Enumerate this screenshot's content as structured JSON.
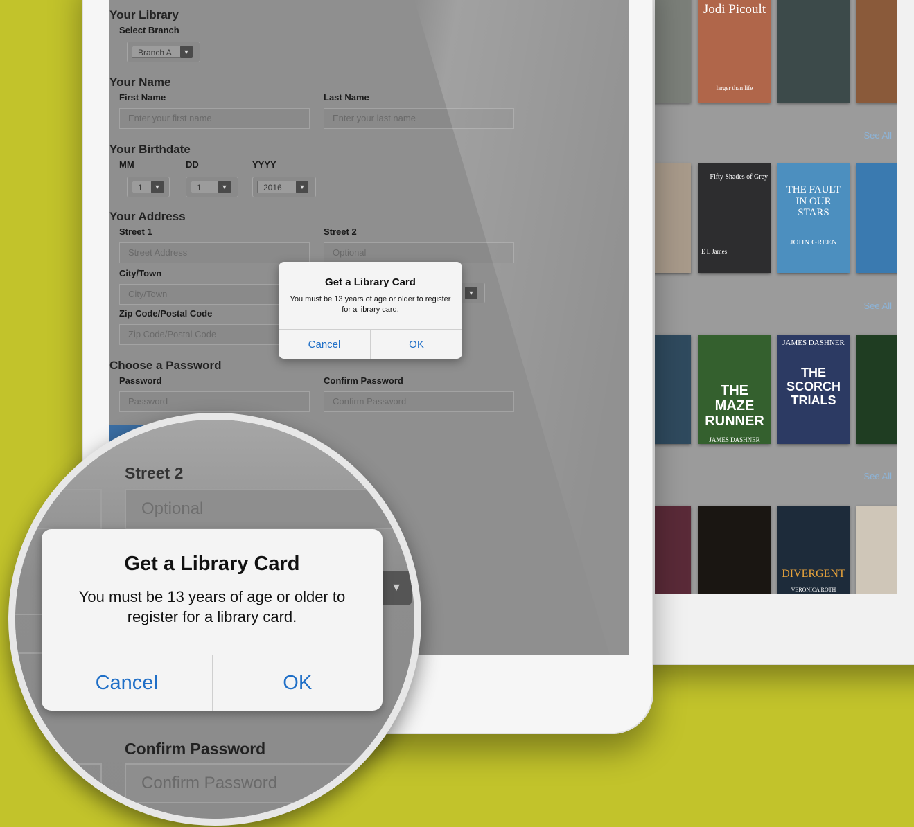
{
  "form": {
    "library_section": "Your Library",
    "branch_label": "Select Branch",
    "branch_value": "Branch A",
    "name_section": "Your Name",
    "first_name_label": "First Name",
    "first_name_placeholder": "Enter your first name",
    "last_name_label": "Last Name",
    "last_name_placeholder": "Enter your last name",
    "birthdate_section": "Your Birthdate",
    "mm_label": "MM",
    "dd_label": "DD",
    "yyyy_label": "YYYY",
    "mm_value": "1",
    "dd_value": "1",
    "yyyy_value": "2016",
    "address_section": "Your Address",
    "street1_label": "Street 1",
    "street1_placeholder": "Street Address",
    "street2_label": "Street 2",
    "street2_placeholder": "Optional",
    "city_label": "City/Town",
    "city_placeholder": "City/Town",
    "zip_label": "Zip Code/Postal Code",
    "zip_placeholder": "Zip Code/Postal Code",
    "password_section": "Choose a Password",
    "password_label": "Password",
    "password_placeholder": "Password",
    "confirm_label": "Confirm Password",
    "confirm_placeholder": "Confirm Password"
  },
  "dialog": {
    "title": "Get a Library Card",
    "message": "You must be 13 years of age or older to register for a library card.",
    "cancel": "Cancel",
    "ok": "OK"
  },
  "catalog": {
    "see_all": "See All",
    "books": [
      {
        "title": "Jodi Picoult",
        "subtitle": "larger than life",
        "color": "#b0664a"
      },
      {
        "title": "Fifty Shades of Grey",
        "subtitle": "E L James",
        "color": "#2d2d2f"
      },
      {
        "title": "THE FAULT IN OUR STARS",
        "subtitle": "JOHN GREEN",
        "color": "#4c8fbf"
      },
      {
        "title": "THE MAZE RUNNER",
        "subtitle": "JAMES DASHNER",
        "color": "#34602e"
      },
      {
        "title": "THE SCORCH TRIALS",
        "subtitle": "JAMES DASHNER",
        "color": "#2c3a63"
      },
      {
        "title": "DIVERGENT",
        "subtitle": "VERONICA ROTH",
        "color": "#1d2b3a"
      }
    ]
  },
  "colors": {
    "background": "#c2c32b",
    "accent": "#1f6fc7"
  }
}
